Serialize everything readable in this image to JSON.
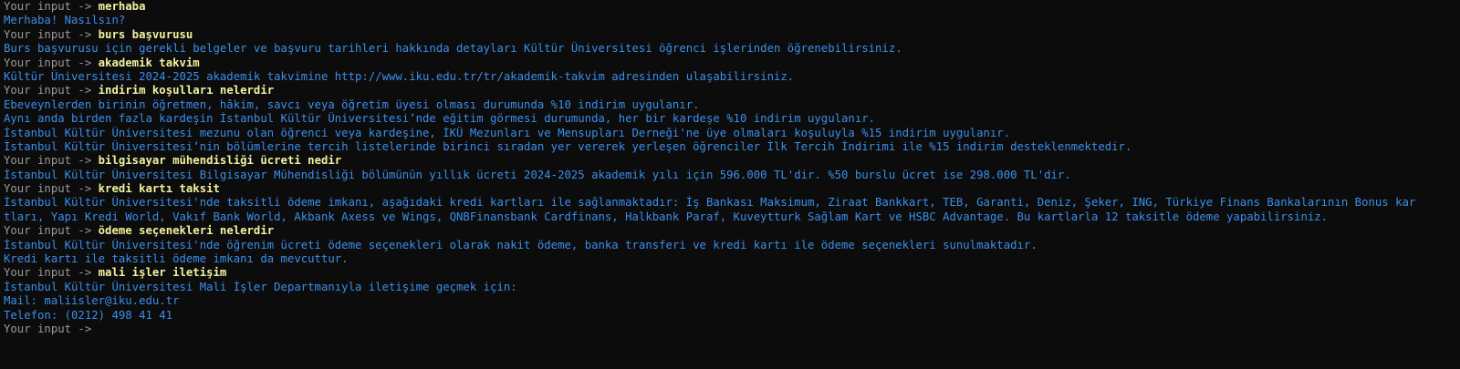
{
  "prompt_label": "Your input -> ",
  "colors": {
    "background": "#0c0c0c",
    "prompt": "#9a9a9a",
    "user_input": "#f2f2a0",
    "bot_response": "#3b8eea"
  },
  "exchanges": [
    {
      "input": "merhaba",
      "response": [
        "Merhaba! Nasılsın?"
      ]
    },
    {
      "input": "burs başvurusu",
      "response": [
        "Burs başvurusu için gerekli belgeler ve başvuru tarihleri hakkında detayları Kültür Üniversitesi öğrenci işlerinden öğrenebilirsiniz."
      ]
    },
    {
      "input": "akademik takvim",
      "response": [
        "Kültür Üniversitesi 2024-2025 akademik takvimine http://www.iku.edu.tr/tr/akademik-takvim adresinden ulaşabilirsiniz."
      ]
    },
    {
      "input": "indirim koşulları nelerdir",
      "response": [
        "Ebeveynlerden birinin öğretmen, hâkim, savcı veya öğretim üyesi olması durumunda %10 indirim uygulanır.",
        "Aynı anda birden fazla kardeşin İstanbul Kültür Üniversitesi’nde eğitim görmesi durumunda, her bir kardeşe %10 indirim uygulanır.",
        "İstanbul Kültür Üniversitesi mezunu olan öğrenci veya kardeşine, İKÜ Mezunları ve Mensupları Derneği'ne üye olmaları koşuluyla %15 indirim uygulanır.",
        "İstanbul Kültür Üniversitesi’nin bölümlerine tercih listelerinde birinci sıradan yer vererek yerleşen öğrenciler İlk Tercih İndirimi ile %15 indirim desteklenmektedir."
      ]
    },
    {
      "input": "bilgisayar mühendisliği ücreti nedir",
      "response": [
        "İstanbul Kültür Üniversitesi Bilgisayar Mühendisliği bölümünün yıllık ücreti 2024-2025 akademik yılı için 596.000 TL'dir. %50 burslu ücret ise 298.000 TL'dir."
      ]
    },
    {
      "input": "kredi kartı taksit",
      "response": [
        "İstanbul Kültür Üniversitesi'nde taksitli ödeme imkanı, aşağıdaki kredi kartları ile sağlanmaktadır: İş Bankası Maksimum, Ziraat Bankkart, TEB, Garanti, Deniz, Şeker, ING, Türkiye Finans Bankalarının Bonus kar",
        "tları, Yapı Kredi World, Vakıf Bank World, Akbank Axess ve Wings, QNBFinansbank Cardfinans, Halkbank Paraf, Kuveytturk Sağlam Kart ve HSBC Advantage. Bu kartlarla 12 taksitle ödeme yapabilirsiniz."
      ]
    },
    {
      "input": "ödeme seçenekleri nelerdir",
      "response": [
        "İstanbul Kültür Üniversitesi'nde öğrenim ücreti ödeme seçenekleri olarak nakit ödeme, banka transferi ve kredi kartı ile ödeme seçenekleri sunulmaktadır.",
        "Kredi kartı ile taksitli ödeme imkanı da mevcuttur."
      ]
    },
    {
      "input": "mali işler iletişim",
      "response": [
        "İstanbul Kültür Üniversitesi Mali İşler Departmanıyla iletişime geçmek için:",
        "Mail: maliisler@iku.edu.tr",
        "Telefon: (0212) 498 41 41"
      ]
    }
  ],
  "final_prompt": {
    "input": ""
  }
}
